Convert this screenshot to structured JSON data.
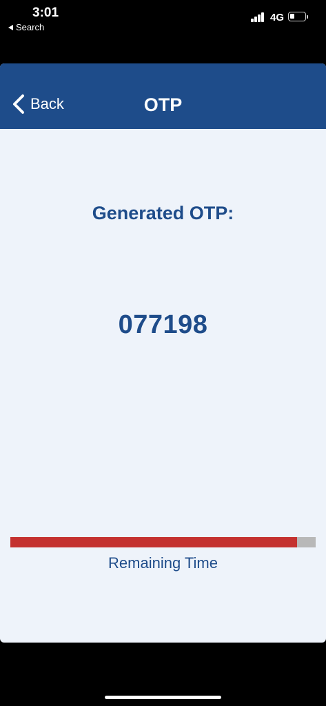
{
  "status_bar": {
    "time": "3:01",
    "back_app": "Search",
    "network": "4G",
    "battery_level": 0.3
  },
  "navbar": {
    "back_label": "Back",
    "title": "OTP"
  },
  "main": {
    "generated_label": "Generated OTP:",
    "otp_code": "077198",
    "remaining_label": "Remaining Time",
    "remaining_fraction": 0.94
  },
  "colors": {
    "nav_background": "#1e4c8a",
    "accent_text": "#1e4c8a",
    "progress_fill": "#c4312f",
    "progress_track": "#b8b8b8",
    "content_background": "#eef3fa"
  }
}
